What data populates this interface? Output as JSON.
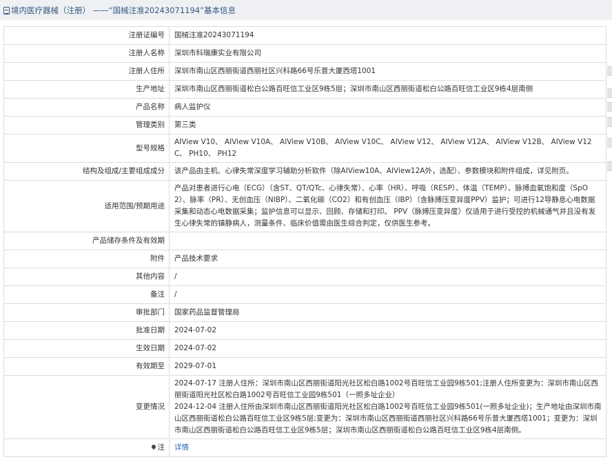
{
  "page": {
    "title": "境内医疗器械（注册） ——“国械注准20243071194”基本信息"
  },
  "rows": [
    {
      "label": "注册证编号",
      "value": "国械注准20243071194"
    },
    {
      "label": "注册人名称",
      "value": "深圳市科瑞康实业有限公司"
    },
    {
      "label": "注册人住所",
      "value": "深圳市南山区西丽街道西丽社区兴科路66号乐普大厦西塔1001"
    },
    {
      "label": "生产地址",
      "value": "深圳市南山区西丽街道松白公路百旺信工业区9栋5层；深圳市南山区西丽街道松白公路百旺信工业区9栋4层南侧"
    },
    {
      "label": "产品名称",
      "value": "病人监护仪"
    },
    {
      "label": "管理类别",
      "value": "第三类"
    },
    {
      "label": "型号规格",
      "value": "AIView V10、 AIView V10A、 AIView V10B、 AIView V10C、 AIView V12、 AIView V12A、 AIView V12B、 AIView V12C、 PH10、 PH12"
    },
    {
      "label": "结构及组成/主要组成成分",
      "value": "该产品由主机、心律失常深度学习辅助分析软件（除AIView10A、AIView12A外，选配）、参数模块和附件组成，详见附页。"
    },
    {
      "label": "适用范围/预期用途",
      "value": "产品对患者进行心电（ECG）（含ST、QT/QTc、心律失常）、心率（HR）、呼吸（RESP）、体温（TEMP）、脉搏血氧饱和度（SpO2）、脉率（PR）、无创血压（NIBP）、二氧化碳（CO2）和有创血压（IBP）（含脉搏压变异度PPV）监护；可进行12导静息心电数据采集和动态心电数据采集；监护信息可以显示、回顾、存储和打印。 PPV（脉搏压变异度）仅适用于进行受控的机械通气并且没有发生心律失常的镇静病人，测量条件、临床价值需由医生综合判定，仅供医生参考。"
    },
    {
      "label": "产品储存条件及有效期",
      "value": ""
    },
    {
      "label": "附件",
      "value": "产品技术要求"
    },
    {
      "label": "其他内容",
      "value": "/"
    },
    {
      "label": "备注",
      "value": "/"
    },
    {
      "label": "审批部门",
      "value": "国家药品监督管理局"
    },
    {
      "label": "批准日期",
      "value": "2024-07-02"
    },
    {
      "label": "生效日期",
      "value": "2024-07-02"
    },
    {
      "label": "有效期至",
      "value": "2029-07-01"
    },
    {
      "label": "变更情况",
      "value": ""
    }
  ],
  "changes": [
    "2024-07-17 注册人住所：深圳市南山区西丽街道阳光社区松白路1002号百旺信工业园9栋501;注册人住所变更为：深圳市南山区西丽街道阳光社区松白路1002号百旺信工业园9栋501（一照多址企业）",
    "2024-12-04 注册人住所由深圳市南山区西丽街道阳光社区松白路1002号百旺信工业园9栋501(一照多址企业)；生产地址由深圳市南山区西丽街道松白公路百旺信工业区9栋5层;变更为：深圳市南山区西丽街道西丽社区兴科路66号乐普大厦西塔1001；变更为：深圳市南山区西丽街道松白公路百旺信工业区9栋5层；深圳市南山区西丽街道松白公路百旺信工业区9栋4层南侧。"
  ],
  "note": {
    "label": "注",
    "link": "详情",
    "icon": "pin-icon"
  }
}
